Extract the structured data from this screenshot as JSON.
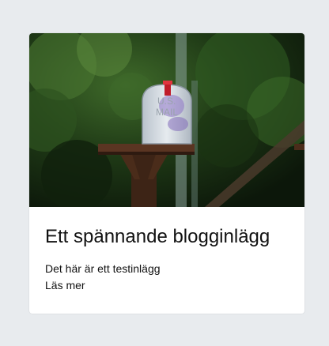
{
  "post": {
    "image_alt": "mailbox-photo",
    "title": "Ett spännande blogginlägg",
    "excerpt": "Det här är ett testinlägg",
    "read_more_label": "Läs mer"
  },
  "colors": {
    "page_background": "#e8ebee",
    "card_background": "#ffffff",
    "text": "#111111"
  }
}
